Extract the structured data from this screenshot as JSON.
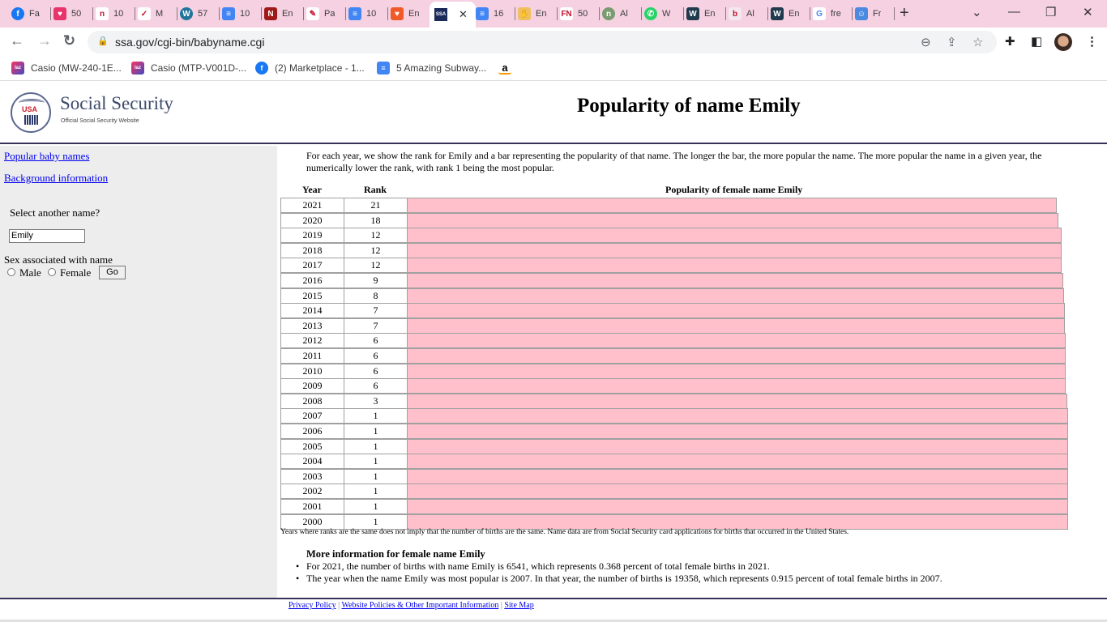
{
  "browser": {
    "tabs": [
      {
        "label": "Fa",
        "icon": "facebook-icon",
        "color": "#1877f2",
        "glyph": "f"
      },
      {
        "label": "50",
        "icon": "heart-icon",
        "color": "#e8336b",
        "glyph": "♥"
      },
      {
        "label": "10",
        "icon": "n-logo-icon",
        "color": "#ffffff",
        "glyph": "n"
      },
      {
        "label": "M",
        "icon": "bird-icon",
        "color": "#ffffff",
        "glyph": "✓"
      },
      {
        "label": "57",
        "icon": "wordpress-icon",
        "color": "#21759b",
        "glyph": "W"
      },
      {
        "label": "10",
        "icon": "google-docs-icon",
        "color": "#4285f4",
        "glyph": "≡"
      },
      {
        "label": "En",
        "icon": "n-red-icon",
        "color": "#a01818",
        "glyph": "N"
      },
      {
        "label": "Pa",
        "icon": "feather-icon",
        "color": "#ffffff",
        "glyph": "✎"
      },
      {
        "label": "10",
        "icon": "google-docs-icon",
        "color": "#4285f4",
        "glyph": "≡"
      },
      {
        "label": "En",
        "icon": "heart-icon",
        "color": "#f05a28",
        "glyph": "♥"
      },
      {
        "label": "",
        "icon": "ssa-icon",
        "color": "#1c2a5a",
        "glyph": "SSA",
        "active": true
      },
      {
        "label": "16",
        "icon": "google-docs-icon",
        "color": "#4285f4",
        "glyph": "≡"
      },
      {
        "label": "En",
        "icon": "hand-icon",
        "color": "#f0c060",
        "glyph": "✋"
      },
      {
        "label": "50",
        "icon": "fn-icon",
        "color": "#ffffff",
        "glyph": "FN"
      },
      {
        "label": "Al",
        "icon": "circle-logo-icon",
        "color": "#7a9a70",
        "glyph": "n"
      },
      {
        "label": "W",
        "icon": "whatsapp-icon",
        "color": "#25d366",
        "glyph": "✆"
      },
      {
        "label": "En",
        "icon": "w-logo-icon",
        "color": "#1f3b4d",
        "glyph": "W"
      },
      {
        "label": "Al",
        "icon": "baby-icon",
        "color": "#f2e8ee",
        "glyph": "b"
      },
      {
        "label": "En",
        "icon": "w-logo-icon",
        "color": "#1f3b4d",
        "glyph": "W"
      },
      {
        "label": "fre",
        "icon": "google-icon",
        "color": "#ffffff",
        "glyph": "G"
      },
      {
        "label": "Fr",
        "icon": "bot-icon",
        "color": "#4a8ae0",
        "glyph": "☺"
      }
    ],
    "active_tab_close": "✕",
    "new_tab": "+",
    "url": "ssa.gov/cgi-bin/babyname.cgi",
    "bookmarks": [
      {
        "label": "Casio (MW-240-1E...",
        "icon": "lazada-icon",
        "color": "#3b4cc0"
      },
      {
        "label": "Casio (MTP-V001D-...",
        "icon": "lazada-icon",
        "color": "#3b4cc0"
      },
      {
        "label": "(2) Marketplace - 1...",
        "icon": "facebook-icon",
        "color": "#1877f2"
      },
      {
        "label": "5 Amazing Subway...",
        "icon": "google-docs-icon",
        "color": "#4285f4"
      },
      {
        "label": "",
        "icon": "amazon-icon",
        "color": "#ffffff"
      }
    ]
  },
  "header": {
    "seal_text": "USA",
    "brand_title": "Social Security",
    "brand_subtitle": "Official Social Security Website",
    "page_title": "Popularity of name Emily"
  },
  "sidebar": {
    "links": [
      "Popular baby names",
      "Background information"
    ],
    "select_label": "Select another name?",
    "name_value": "Emily",
    "sex_label": "Sex associated with name",
    "male_label": "Male",
    "female_label": "Female",
    "go_label": "Go"
  },
  "content": {
    "intro": "For each year, we show the rank for Emily and a bar representing the popularity of that name. The longer the bar, the more popular the name. The more popular the name in a given year, the numerically lower the rank, with rank 1 being the most popular.",
    "col_year": "Year",
    "col_rank": "Rank",
    "col_bar": "Popularity of female name Emily",
    "bar_color": "#ffc0cb",
    "footnote": "Years where ranks are the same does not imply that the number of births are the same. Name data are from Social Security card applications for births that occurred in the United States.",
    "more_title": "More information for female name Emily",
    "more_items": [
      "For 2021, the number of births with name Emily is 6541, which represents 0.368 percent of total female births in 2021.",
      "The year when the name Emily was most popular is 2007. In that year, the number of births is 19358, which represents 0.915 percent of total female births in 2007."
    ]
  },
  "chart_data": {
    "type": "table",
    "title": "Popularity of female name Emily",
    "columns": [
      "Year",
      "Rank",
      "Popularity bar"
    ],
    "rows": [
      {
        "year": "2021",
        "rank": "21"
      },
      {
        "year": "2020",
        "rank": "18"
      },
      {
        "year": "2019",
        "rank": "12"
      },
      {
        "year": "2018",
        "rank": "12"
      },
      {
        "year": "2017",
        "rank": "12"
      },
      {
        "year": "2016",
        "rank": "9"
      },
      {
        "year": "2015",
        "rank": "8"
      },
      {
        "year": "2014",
        "rank": "7"
      },
      {
        "year": "2013",
        "rank": "7"
      },
      {
        "year": "2012",
        "rank": "6"
      },
      {
        "year": "2011",
        "rank": "6"
      },
      {
        "year": "2010",
        "rank": "6"
      },
      {
        "year": "2009",
        "rank": "6"
      },
      {
        "year": "2008",
        "rank": "3"
      },
      {
        "year": "2007",
        "rank": "1"
      },
      {
        "year": "2006",
        "rank": "1"
      },
      {
        "year": "2005",
        "rank": "1"
      },
      {
        "year": "2004",
        "rank": "1"
      },
      {
        "year": "2003",
        "rank": "1"
      },
      {
        "year": "2002",
        "rank": "1"
      },
      {
        "year": "2001",
        "rank": "1"
      },
      {
        "year": "2000",
        "rank": "1"
      }
    ]
  },
  "footer": {
    "links": [
      "Privacy Policy",
      "Website Policies & Other Important Information",
      "Site Map"
    ],
    "separator": "|"
  }
}
